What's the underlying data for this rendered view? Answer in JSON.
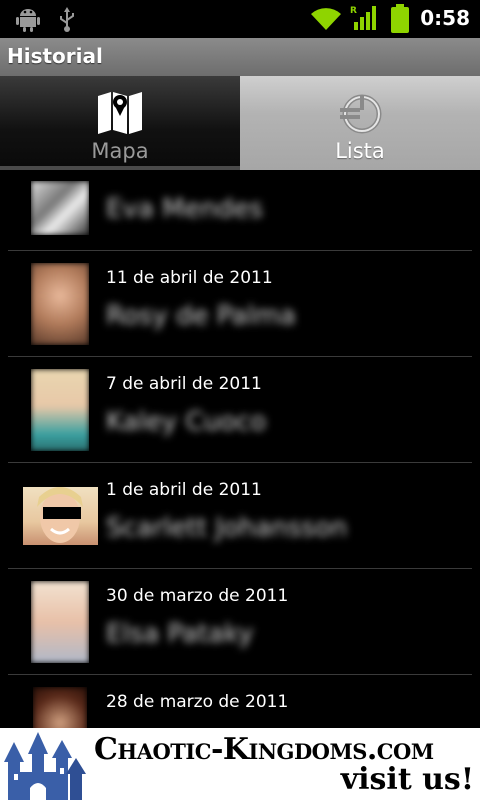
{
  "status_bar": {
    "time": "0:58"
  },
  "app": {
    "title": "Historial"
  },
  "tabs": [
    {
      "label": "Mapa",
      "icon": "map-icon",
      "selected": false
    },
    {
      "label": "Lista",
      "icon": "list-icon",
      "selected": true
    }
  ],
  "items": [
    {
      "date": "",
      "name": "Eva Mendes"
    },
    {
      "date": "11 de abril de 2011",
      "name": "Rosy de Palma"
    },
    {
      "date": "7 de abril de 2011",
      "name": "Kaley Cuoco"
    },
    {
      "date": "1 de abril de 2011",
      "name": "Scarlett Johansson"
    },
    {
      "date": "30 de marzo de 2011",
      "name": "Elsa Pataky"
    },
    {
      "date": "28 de marzo de 2011",
      "name": ""
    }
  ],
  "ad": {
    "brand": "Chaotic-Kingdoms.com",
    "cta": "visit us!"
  }
}
